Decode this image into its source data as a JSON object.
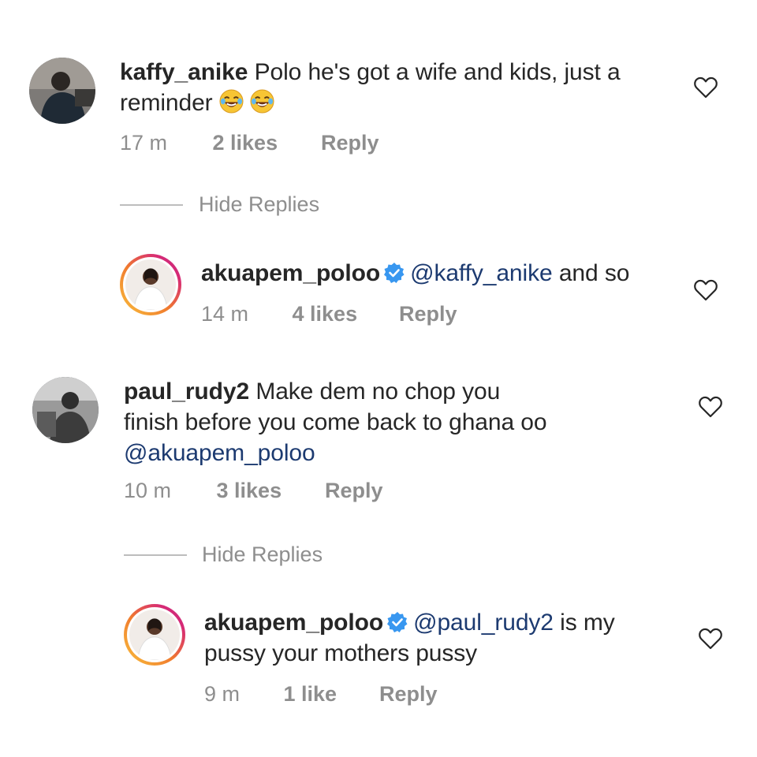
{
  "comments": [
    {
      "username": "kaffy_anike",
      "text": "Polo he's got a wife and kids, just a",
      "text_line2": "reminder",
      "emoji": "😂😂",
      "time": "17 m",
      "likes": "2 likes",
      "reply": "Reply",
      "hide_replies": "Hide Replies",
      "avatar_icon": "user-photo-dark"
    },
    {
      "username": "akuapem_poloo",
      "verified": true,
      "mention": "@kaffy_anike",
      "text": "and so",
      "time": "14 m",
      "likes": "4 likes",
      "reply": "Reply",
      "avatar_icon": "user-photo-white-outfit"
    },
    {
      "username": "paul_rudy2",
      "text": "Make dem no chop you",
      "text_line2": "finish before you come back to ghana oo",
      "mention_line3": "@akuapem_poloo",
      "time": "10 m",
      "likes": "3 likes",
      "reply": "Reply",
      "hide_replies": "Hide Replies",
      "avatar_icon": "user-photo-grayscale"
    },
    {
      "username": "akuapem_poloo",
      "verified": true,
      "mention": "@paul_rudy2",
      "text": "is my",
      "text_line2": "pussy your mothers pussy",
      "time": "9 m",
      "likes": "1 like",
      "reply": "Reply",
      "avatar_icon": "user-photo-white-outfit"
    }
  ],
  "colors": {
    "text": "#262626",
    "meta": "#8e8e8e",
    "mention": "#1c3a70",
    "verified": "#3897f0"
  }
}
